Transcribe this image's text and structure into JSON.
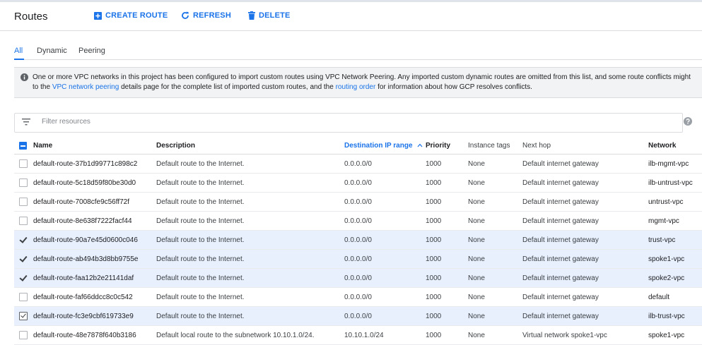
{
  "header": {
    "title": "Routes",
    "create_label": "CREATE ROUTE",
    "refresh_label": "REFRESH",
    "delete_label": "DELETE"
  },
  "tabs": [
    "All",
    "Dynamic",
    "Peering"
  ],
  "banner": {
    "part1": "One or more VPC networks in this project has been configured to import custom routes using VPC Network Peering. Any imported custom dynamic routes are omitted from this list, and some route conflicts might",
    "part2": "to the ",
    "link1": "VPC network peering",
    "part3": " details page for the complete list of imported custom routes, and the ",
    "link2": "routing order",
    "part4": " for information about how GCP resolves conflicts."
  },
  "filter": {
    "placeholder": "Filter resources"
  },
  "columns": {
    "name": "Name",
    "description": "Description",
    "dest": "Destination IP range",
    "priority": "Priority",
    "tags": "Instance tags",
    "nexthop": "Next hop",
    "network": "Network"
  },
  "rows": [
    {
      "checked": false,
      "name": "default-route-37b1d99771c898c2",
      "description": "Default route to the Internet.",
      "dest": "0.0.0.0/0",
      "priority": "1000",
      "tags": "None",
      "nexthop": "Default internet gateway",
      "network": "ilb-mgmt-vpc"
    },
    {
      "checked": false,
      "name": "default-route-5c18d59f80be30d0",
      "description": "Default route to the Internet.",
      "dest": "0.0.0.0/0",
      "priority": "1000",
      "tags": "None",
      "nexthop": "Default internet gateway",
      "network": "ilb-untrust-vpc"
    },
    {
      "checked": false,
      "name": "default-route-7008cfe9c56ff72f",
      "description": "Default route to the Internet.",
      "dest": "0.0.0.0/0",
      "priority": "1000",
      "tags": "None",
      "nexthop": "Default internet gateway",
      "network": "untrust-vpc"
    },
    {
      "checked": false,
      "name": "default-route-8e638f7222facf44",
      "description": "Default route to the Internet.",
      "dest": "0.0.0.0/0",
      "priority": "1000",
      "tags": "None",
      "nexthop": "Default internet gateway",
      "network": "mgmt-vpc"
    },
    {
      "checked": true,
      "name": "default-route-90a7e45d0600c046",
      "description": "Default route to the Internet.",
      "dest": "0.0.0.0/0",
      "priority": "1000",
      "tags": "None",
      "nexthop": "Default internet gateway",
      "network": "trust-vpc"
    },
    {
      "checked": true,
      "name": "default-route-ab494b3d8bb9755e",
      "description": "Default route to the Internet.",
      "dest": "0.0.0.0/0",
      "priority": "1000",
      "tags": "None",
      "nexthop": "Default internet gateway",
      "network": "spoke1-vpc"
    },
    {
      "checked": true,
      "name": "default-route-faa12b2e21141daf",
      "description": "Default route to the Internet.",
      "dest": "0.0.0.0/0",
      "priority": "1000",
      "tags": "None",
      "nexthop": "Default internet gateway",
      "network": "spoke2-vpc"
    },
    {
      "checked": false,
      "name": "default-route-faf66ddcc8c0c542",
      "description": "Default route to the Internet.",
      "dest": "0.0.0.0/0",
      "priority": "1000",
      "tags": "None",
      "nexthop": "Default internet gateway",
      "network": "default"
    },
    {
      "checked": true,
      "focused": true,
      "name": "default-route-fc3e9cbf619733e9",
      "description": "Default route to the Internet.",
      "dest": "0.0.0.0/0",
      "priority": "1000",
      "tags": "None",
      "nexthop": "Default internet gateway",
      "network": "ilb-trust-vpc"
    },
    {
      "checked": false,
      "name": "default-route-48e7878f640b3186",
      "description": "Default local route to the subnetwork 10.10.1.0/24.",
      "dest": "10.10.1.0/24",
      "priority": "1000",
      "tags": "None",
      "nexthop": "Virtual network spoke1-vpc",
      "network": "spoke1-vpc"
    }
  ],
  "colors": {
    "accent": "#1a73e8",
    "selected_row": "#e8f0fe",
    "banner_bg": "#f1f3f4"
  }
}
